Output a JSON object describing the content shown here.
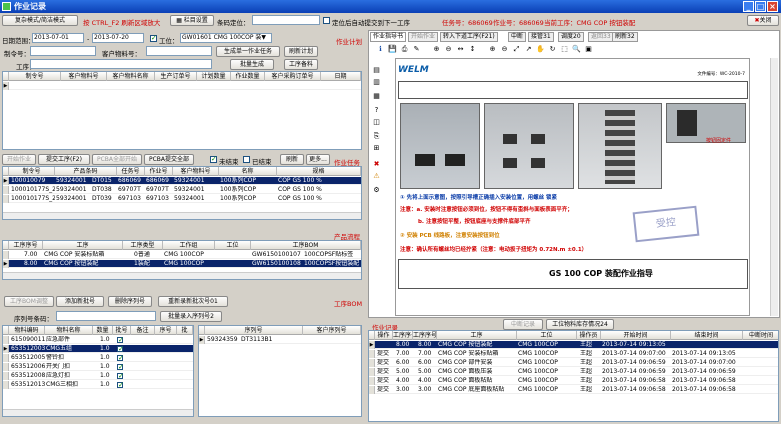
{
  "window": {
    "title": "作业记录",
    "close_label": "关闭"
  },
  "toolbar": {
    "mode_button": "复杂模式/简洁模式",
    "hint": "按 CTRL_F2 刷新区域放大",
    "settings_button": "栏目设置",
    "scan_label": "条码定位：",
    "scan_value": "",
    "auto_submit_label": "定位后自动提交到下一工序",
    "task_no": "任务号：686069",
    "job_no": "作业号：686069",
    "current_process": "当前工序：CMG COP 按钮装配"
  },
  "filter": {
    "date_label": "日期范围：",
    "date_from": "2013-07-01",
    "date_to": "2013-07-20",
    "station_label": "工位：",
    "station_value": "GW01601 CMG 100COP 装▼",
    "section_title": "作业计划",
    "order_label": "制令号：",
    "order_value": "",
    "customer_part_label": "客户物料号：",
    "customer_part_value": "",
    "gen_task_button": "生成单一作业任务",
    "refresh_plan_button": "刷新计划",
    "process_label": "工序：",
    "process_value": "",
    "batch_gen_button": "批量生成",
    "process_note_button": "工序备料"
  },
  "plan_table": {
    "headers": [
      "制令号",
      "客户物料号",
      "客户物料名称",
      "生产订单号",
      "计划数量",
      "作业数量",
      "客户采购订单号",
      "日期"
    ],
    "rows": []
  },
  "mid_toolbar": {
    "start_btn": "开始作业",
    "submit_btn": "提交工序(F2)",
    "pcb_start": "PCBA全部开始",
    "pcb_submit": "PCBA提交全部",
    "unfinished_label": "未结束",
    "finished_label": "已结束",
    "refresh": "刷新",
    "more": "更多...",
    "section_title": "作业任务"
  },
  "task_table": {
    "headers": [
      "制令号",
      "产品条码",
      "任务号",
      "作业号",
      "客户物料号",
      "名称",
      "规格"
    ],
    "rows": [
      {
        "order": "100010079",
        "barcode": "59324001",
        "batch": "DT015",
        "task": "686069",
        "job": "686069",
        "part": "59324001",
        "name": "100系列COP",
        "spec": "COP GS 100 %"
      },
      {
        "order": "100010177S_2",
        "barcode": "59324001",
        "batch": "DT038",
        "task": "69707T",
        "job": "69707T",
        "part": "59324001",
        "name": "100系列COP",
        "spec": "COP GS 100 %"
      },
      {
        "order": "100010177S_2",
        "barcode": "59324001",
        "batch": "DT039",
        "task": "697103",
        "job": "697103",
        "part": "59324001",
        "name": "100系列COP",
        "spec": "COP GS 100 %"
      }
    ]
  },
  "process_section": {
    "title": "产品流程",
    "headers": [
      "工序序号",
      "工序",
      "工序类型",
      "工作组",
      "工位",
      "工序BOM"
    ],
    "rows": [
      {
        "seq": "7.00",
        "proc": "CMG COP 安装标贴箱",
        "type": "0普通",
        "group": "CMG 100COP",
        "station": "GW6150100107",
        "bom": "100COPSF贴标签"
      },
      {
        "seq": "8.00",
        "proc": "CMG COP 按钮装配",
        "type": "1装配",
        "group": "CMG 100COP",
        "station": "GW6150100108",
        "bom": "100COPSF按钮装配"
      }
    ]
  },
  "bom_section": {
    "btn1": "工序BOM调整",
    "btn2": "添加新批号",
    "btn3": "删除序列号",
    "btn4": "重新录新批次号01",
    "title": "工序BOM",
    "serial_label": "序列号条码：",
    "batch_btn": "批量录入序列号2",
    "headers": [
      "物料编码",
      "物料名称",
      "数量",
      "批号",
      "备注",
      "序号",
      "批"
    ],
    "rows": [
      {
        "code": "6150900110",
        "name": "应急部件",
        "qty": "1.0",
        "chk": true
      },
      {
        "code": "6535120030",
        "name": "CMG五组",
        "qty": "1.0",
        "chk": true
      },
      {
        "code": "6535120050",
        "name": "警铃扣",
        "qty": "1.0",
        "chk": true
      },
      {
        "code": "6535120060",
        "name": "开关门扣",
        "qty": "1.0",
        "chk": true
      },
      {
        "code": "6535120080",
        "name": "应急灯扣",
        "qty": "1.0",
        "chk": true
      },
      {
        "code": "6535120130",
        "name": "CMG三相扣",
        "qty": "1.0",
        "chk": true
      }
    ],
    "serial_headers": [
      "序列号",
      "客户序列号"
    ],
    "serial_rows": [
      {
        "sn": "59324359",
        "csn": "DT3113B1"
      }
    ]
  },
  "doc_tabs": [
    "作业指导书",
    "开始作业",
    "转入下道工序(F21)",
    "中断",
    "接管31",
    "调度20",
    "返回33",
    "刷新32"
  ],
  "doc": {
    "brand": "WELM",
    "doc_no": "文件编号：WC-2010-7",
    "caption1": "① 先将上面示意图，按照引导槽正确插入安装位置，用螺丝  锁紧",
    "caption2": "注意：a. 安装时注意按钮必须到位，按钮不得有歪斜与面板表面平齐；",
    "caption3": "b. 注意按钮平整，按钮底座与支撑件底部平齐",
    "caption4": "② 安装 PCB 线路板，注意安装按钮到位",
    "caption5": "注意：确认所有螺丝均已经拧紧（注意：电动扳子扭矩为 0.72N.m ±0.1）",
    "footer_title": "GS 100 COP 装配作业指导",
    "red_label": "按钮固定件",
    "stamp": "受控"
  },
  "records": {
    "title": "作业记录",
    "btn1": "中断记录",
    "btn2": "工位物料库存情况24",
    "headers": [
      "操作",
      "工序序号",
      "工序序号",
      "工序",
      "工位",
      "操作员",
      "开始时间",
      "结束时间",
      "中断时间"
    ],
    "rows": [
      {
        "op": "",
        "seq": "8.00",
        "seq2": "8.00",
        "proc": "CMG COP 按钮装配",
        "station": "CMG 100COP",
        "user": "王超",
        "start": "2013-07-14 09:13:05",
        "end": "",
        "sel": true
      },
      {
        "op": "提交",
        "seq": "7.00",
        "seq2": "7.00",
        "proc": "CMG COP 安装标贴箱",
        "station": "CMG 100COP",
        "user": "王超",
        "start": "2013-07-14 09:07:00",
        "end": "2013-07-14 09:13:05"
      },
      {
        "op": "提交",
        "seq": "6.00",
        "seq2": "6.00",
        "proc": "CMG COP 部件安装",
        "station": "CMG 100COP",
        "user": "王超",
        "start": "2013-07-14 09:06:59",
        "end": "2013-07-14 09:07:00"
      },
      {
        "op": "提交",
        "seq": "5.00",
        "seq2": "5.00",
        "proc": "CMG COP 面板压装",
        "station": "CMG 100COP",
        "user": "王超",
        "start": "2013-07-14 09:06:59",
        "end": "2013-07-14 09:06:59"
      },
      {
        "op": "提交",
        "seq": "4.00",
        "seq2": "4.00",
        "proc": "CMG COP 面板粘贴",
        "station": "CMG 100COP",
        "user": "王超",
        "start": "2013-07-14 09:06:58",
        "end": "2013-07-14 09:06:58"
      },
      {
        "op": "提交",
        "seq": "3.00",
        "seq2": "3.00",
        "proc": "CMG COP 底座面板粘贴",
        "station": "CMG 100COP",
        "user": "王超",
        "start": "2013-07-14 09:06:58",
        "end": "2013-07-14 09:06:58"
      }
    ]
  }
}
